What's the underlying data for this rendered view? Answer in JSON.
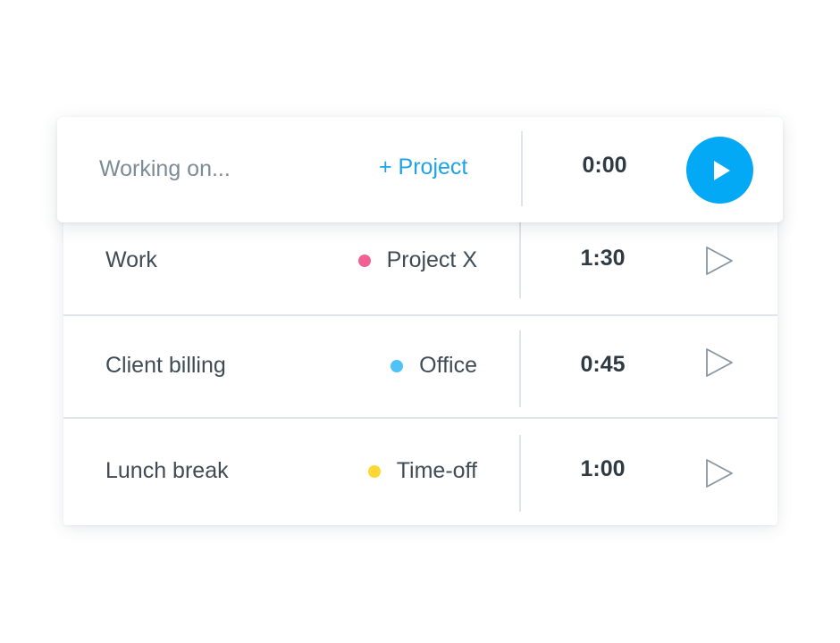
{
  "timer": {
    "description_placeholder": "Working on...",
    "add_project_label": "+ Project",
    "elapsed": "0:00",
    "start_icon": "play-icon"
  },
  "entries": [
    {
      "description": "Work",
      "project": "Project X",
      "project_color": "#f06292",
      "duration": "1:30",
      "play_icon": "play-outline-icon"
    },
    {
      "description": "Client billing",
      "project": "Office",
      "project_color": "#4fc3f7",
      "duration": "0:45",
      "play_icon": "play-outline-icon"
    },
    {
      "description": "Lunch break",
      "project": "Time-off",
      "project_color": "#fdd835",
      "duration": "1:00",
      "play_icon": "play-outline-icon"
    }
  ],
  "colors": {
    "accent": "#03a9f4",
    "link": "#1fa3e6",
    "text": "#3f4b55",
    "divider": "#dfe5ea"
  }
}
